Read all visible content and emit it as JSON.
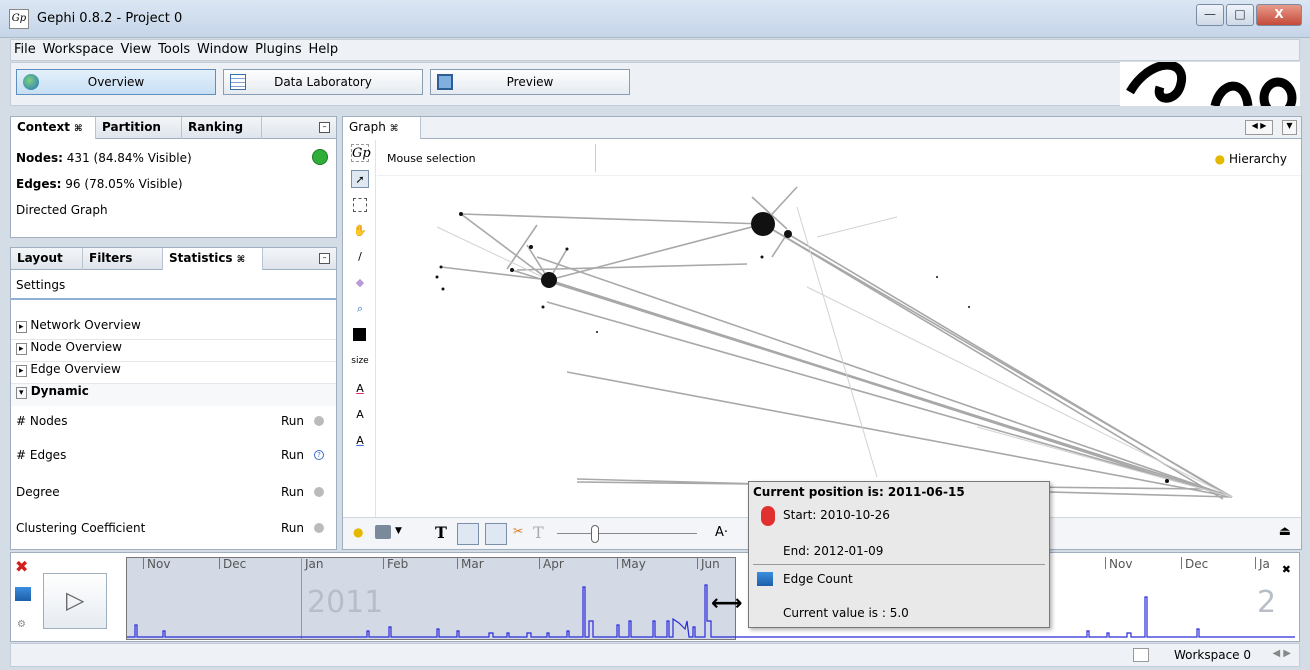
{
  "window": {
    "title": "Gephi 0.8.2 - Project 0",
    "app_icon": "Gp",
    "minimize": "—",
    "maximize": "□",
    "close": "X"
  },
  "menu": [
    "File",
    "Workspace",
    "View",
    "Tools",
    "Window",
    "Plugins",
    "Help"
  ],
  "modes": {
    "overview": "Overview",
    "data_lab": "Data Laboratory",
    "preview": "Preview"
  },
  "context_panel": {
    "tabs": [
      "Context",
      "Partition",
      "Ranking"
    ],
    "nodes_label": "Nodes:",
    "nodes_value": "431 (84.84% Visible)",
    "edges_label": "Edges:",
    "edges_value": "96 (78.05% Visible)",
    "graph_type": "Directed Graph"
  },
  "stats_panel": {
    "tabs": [
      "Layout",
      "Filters",
      "Statistics"
    ],
    "settings": "Settings",
    "sections": [
      "Network Overview",
      "Node Overview",
      "Edge Overview",
      "Dynamic"
    ],
    "run_label": "Run",
    "metrics": [
      "# Nodes",
      "# Edges",
      "Degree",
      "Clustering Coefficient"
    ]
  },
  "graph_panel": {
    "tab": "Graph",
    "mode": "Mouse selection",
    "hierarchy": "Hierarchy",
    "size_label": "size"
  },
  "timeline": {
    "months": [
      "Nov",
      "Dec",
      "Jan",
      "Feb",
      "Mar",
      "Apr",
      "May",
      "Jun",
      "Nov",
      "Dec",
      "Ja"
    ],
    "year_left": "2011",
    "year_right": "2"
  },
  "tooltip": {
    "heading": "Current position is: 2011-06-15",
    "start": "Start: 2010-10-26",
    "end": "End: 2012-01-09",
    "metric": "Edge Count",
    "value": "Current value is : 5.0"
  },
  "status": {
    "workspace": "Workspace 0"
  },
  "colors": {
    "accent": "#2a2ad8",
    "selection": "#d3dae6"
  }
}
